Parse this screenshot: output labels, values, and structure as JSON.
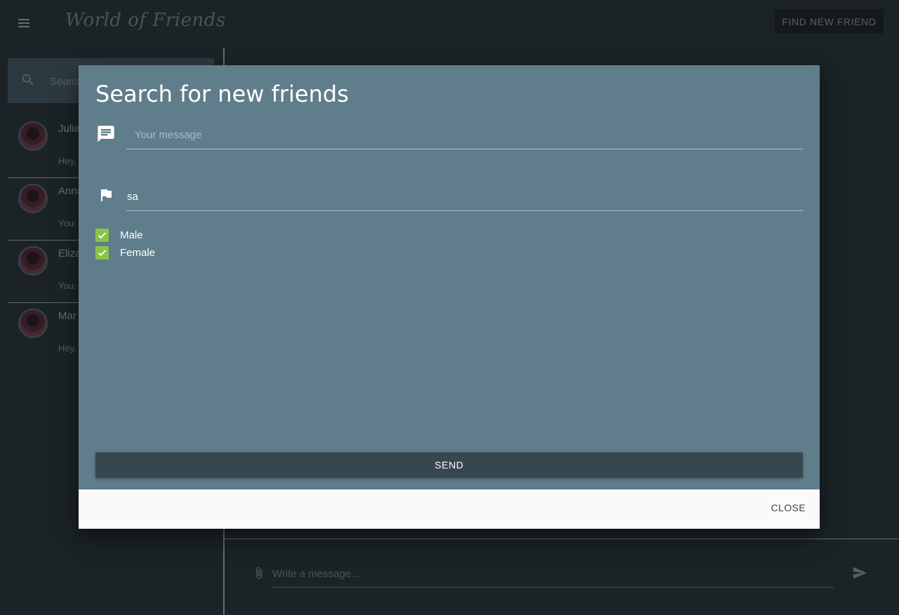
{
  "app": {
    "brand": "World of Friends",
    "find_button_label": "FIND NEW FRIEND"
  },
  "sidebar": {
    "search_placeholder": "Search",
    "contacts": [
      {
        "name": "Julia",
        "preview": "Hey,"
      },
      {
        "name": "Anna",
        "preview": "You:"
      },
      {
        "name": "Eliza",
        "preview": "You:"
      },
      {
        "name": "Mar",
        "preview": "Hey,"
      }
    ]
  },
  "composer": {
    "placeholder": "Write a message..."
  },
  "modal": {
    "title": "Search for new friends",
    "message_placeholder": "Your message",
    "country_value": "sa",
    "checkboxes": [
      {
        "label": "Male",
        "checked": true
      },
      {
        "label": "Female",
        "checked": true
      }
    ],
    "send_label": "SEND",
    "close_label": "CLOSE"
  },
  "colors": {
    "modal_bg": "#607d8b",
    "app_bg": "#37474f",
    "checkbox": "#8bc34a",
    "footer_bg": "#fafafa"
  }
}
